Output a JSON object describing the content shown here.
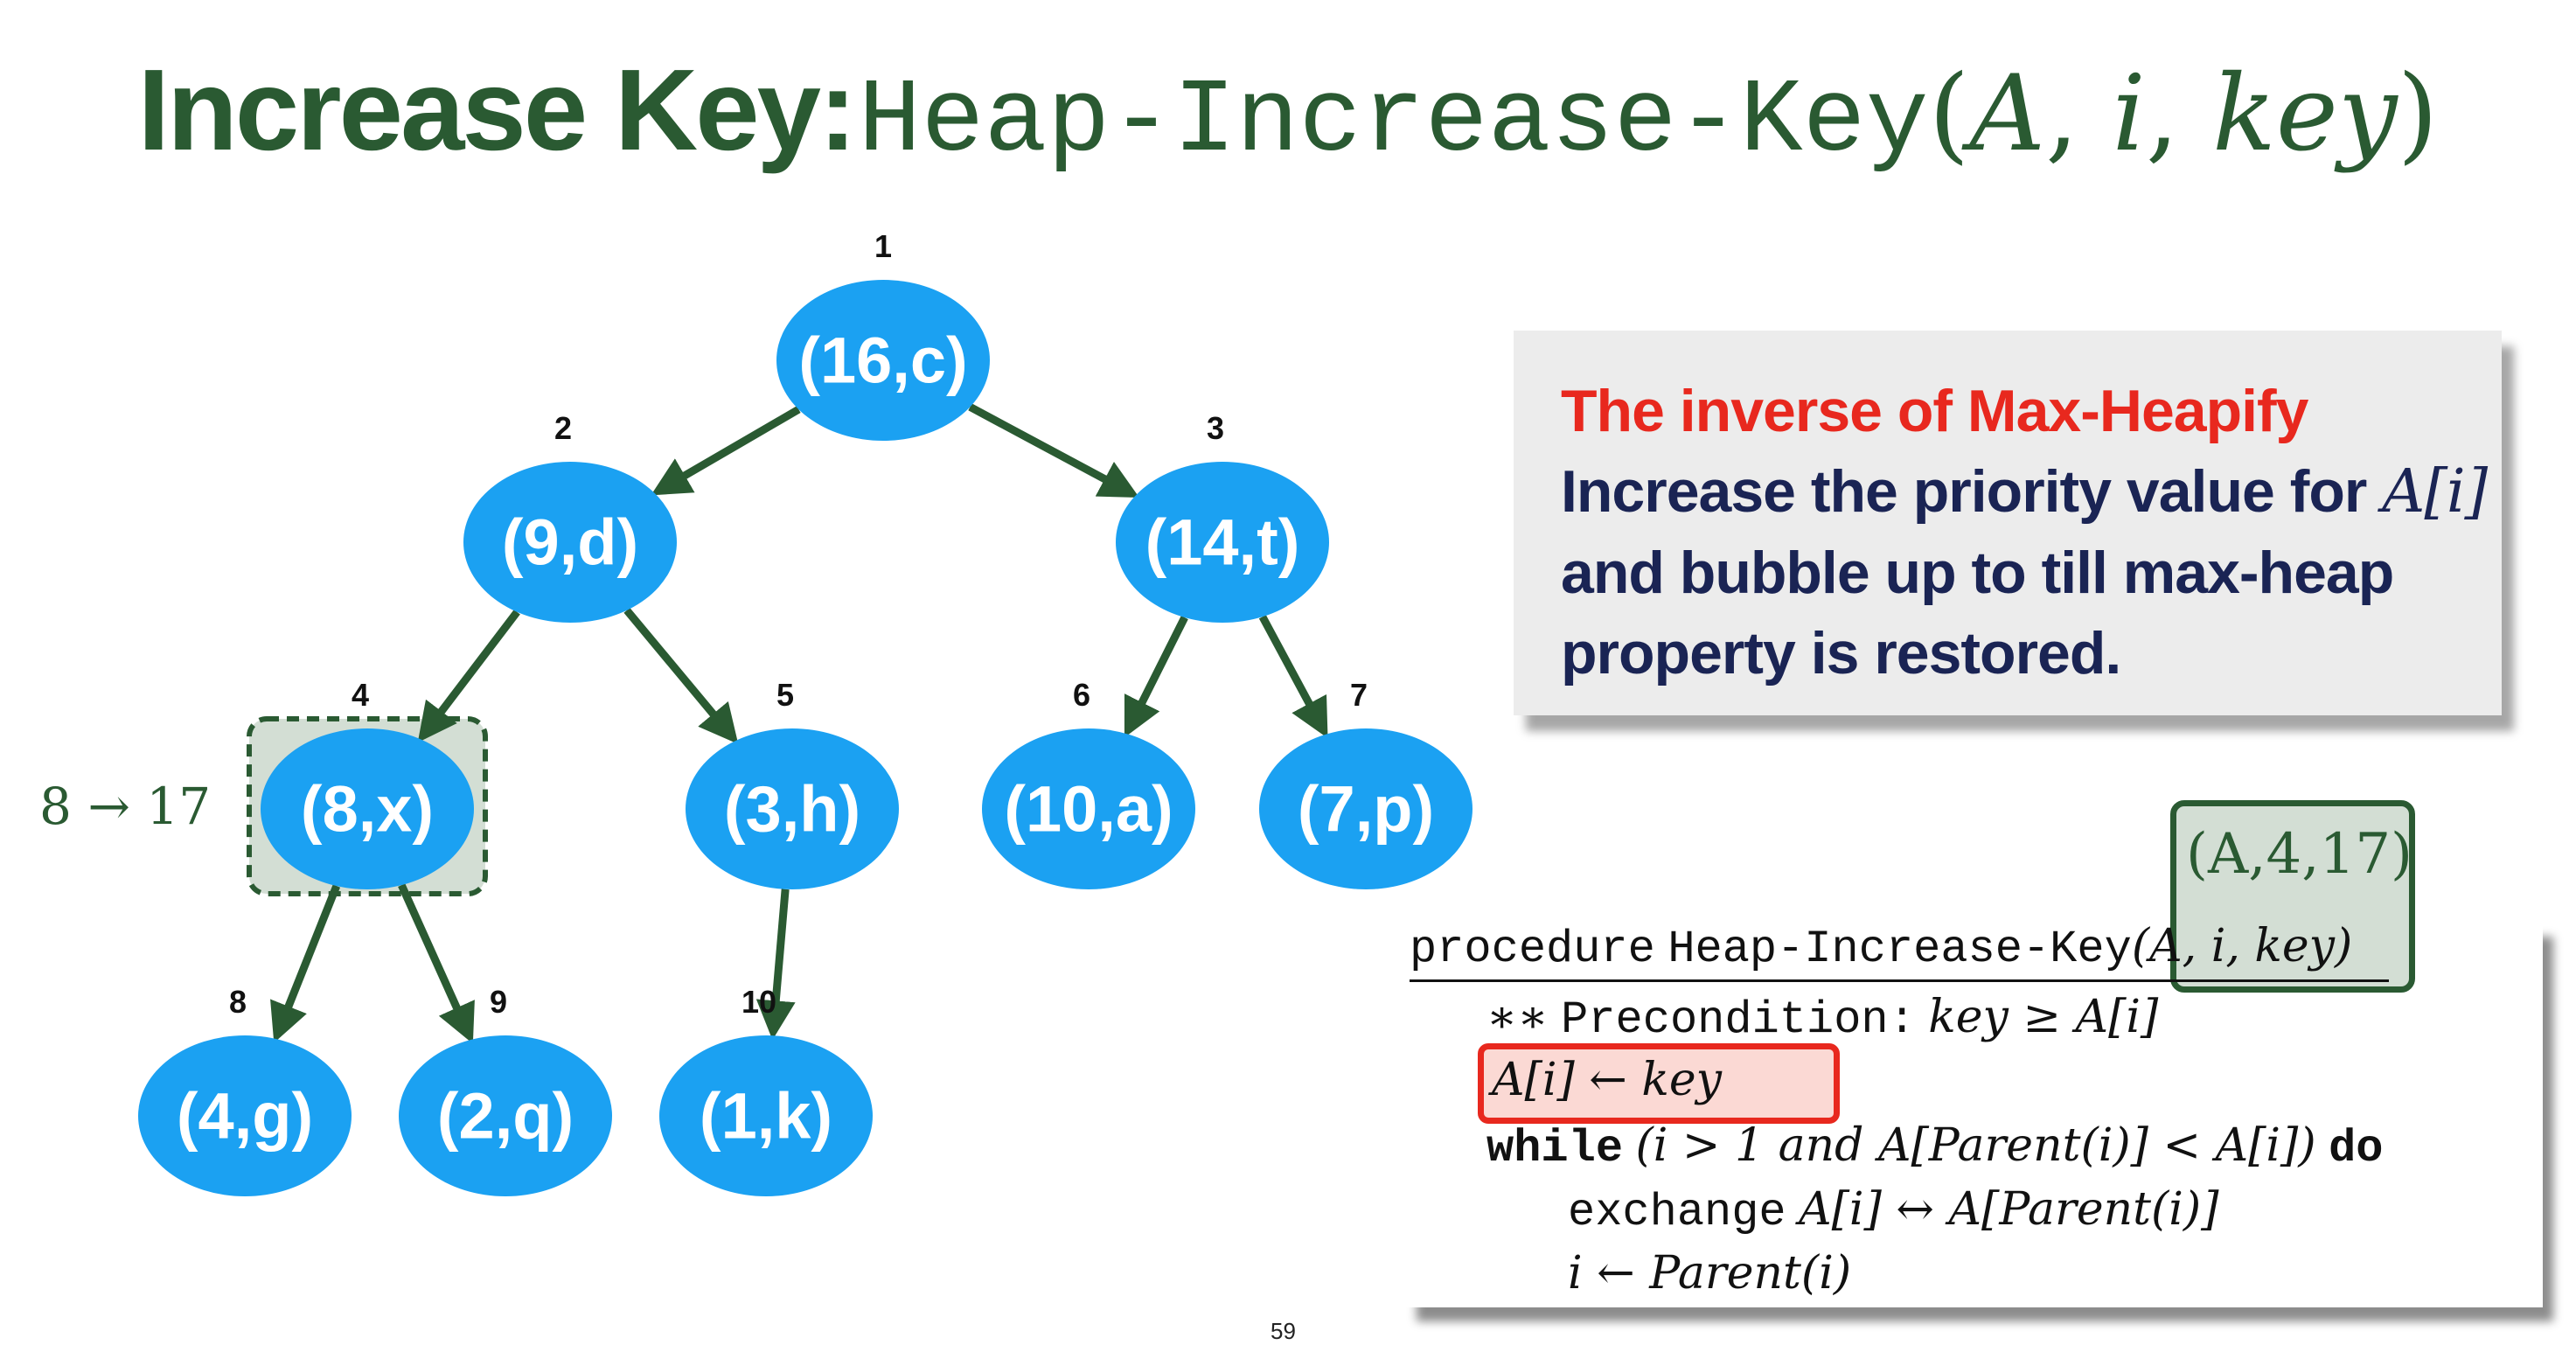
{
  "title": {
    "bold": "Increase Key:",
    "func": "Heap-Increase-Key",
    "open": "(",
    "arg1": "A",
    "arg2": "i",
    "arg3": "key",
    "close": ")"
  },
  "tree": {
    "nodes": [
      {
        "index": "1",
        "label": "(16,c)",
        "highlighted": false
      },
      {
        "index": "2",
        "label": "(9,d)",
        "highlighted": false
      },
      {
        "index": "3",
        "label": "(14,t)",
        "highlighted": false
      },
      {
        "index": "4",
        "label": "(8,x)",
        "highlighted": true
      },
      {
        "index": "5",
        "label": "(3,h)",
        "highlighted": false
      },
      {
        "index": "6",
        "label": "(10,a)",
        "highlighted": false
      },
      {
        "index": "7",
        "label": "(7,p)",
        "highlighted": false
      },
      {
        "index": "8",
        "label": "(4,g)",
        "highlighted": false
      },
      {
        "index": "9",
        "label": "(2,q)",
        "highlighted": false
      },
      {
        "index": "10",
        "label": "(1,k)",
        "highlighted": false
      }
    ],
    "edges": [
      [
        1,
        2
      ],
      [
        1,
        3
      ],
      [
        2,
        4
      ],
      [
        2,
        5
      ],
      [
        3,
        6
      ],
      [
        3,
        7
      ],
      [
        4,
        8
      ],
      [
        4,
        9
      ],
      [
        5,
        10
      ]
    ],
    "colors": {
      "node": "#1ba1f2",
      "edge": "#2a5a32",
      "highlight_fill": "#d3ded4",
      "highlight_border": "#2a5a32"
    }
  },
  "note": "8 → 17",
  "callout": {
    "heading": "The inverse of Max-Heapify",
    "line1": "Increase the priority value for ",
    "line1_math": "A[i]",
    "line2": "and bubble up to till max-heap",
    "line3": "property is restored."
  },
  "code": {
    "procedure_kw": "procedure",
    "procedure_name": "Heap-Increase-Key",
    "procedure_args": "(A, i, key)",
    "precondition_star": "∗∗",
    "precondition_label": "Precondition:",
    "precondition_expr": "key ≥ A[i]",
    "assign": "A[i] ← key",
    "while_kw": "while",
    "while_cond": "(i > 1 and A[Parent(i)] < A[i])",
    "do_kw": "do",
    "exchange_kw": "exchange",
    "exchange_expr": "A[i] ↔ A[Parent(i)]",
    "update": "i ← Parent(i)"
  },
  "call_args": "(A,4,17)",
  "page_number": "59"
}
